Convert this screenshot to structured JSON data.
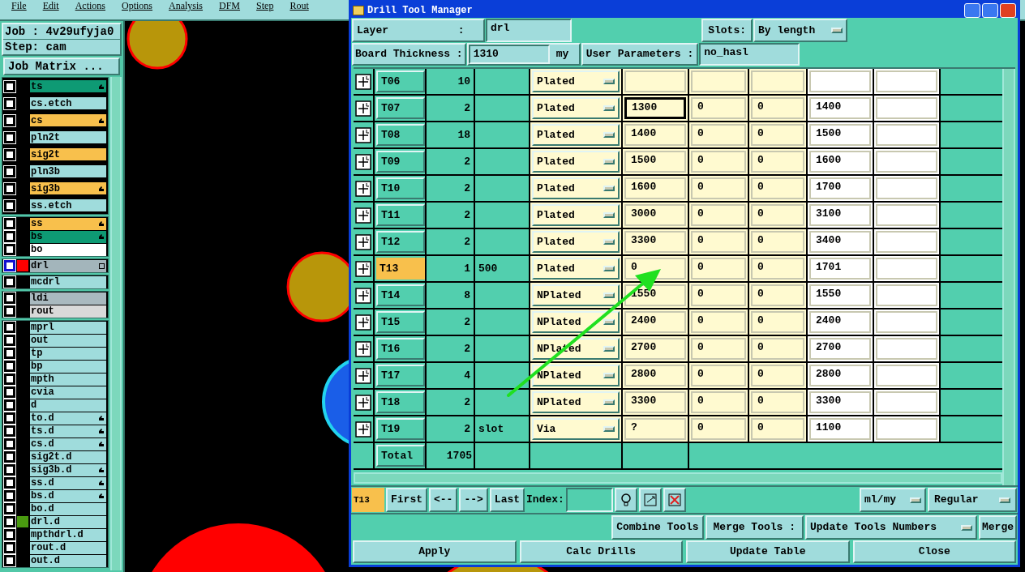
{
  "menu_bar": [
    "File",
    "Edit",
    "Actions",
    "Options",
    "Analysis",
    "DFM",
    "Step",
    "Rout"
  ],
  "job": {
    "job_label": "Job : 4v29ufyja0",
    "step_label": "Step: cam",
    "matrix_button": "Job Matrix ..."
  },
  "layer_groups": [
    [
      {
        "name": "ts",
        "color": "#0e9a74",
        "affected": true,
        "checked": false
      },
      {
        "name": "cs.etch",
        "color": "#9fdcdc",
        "affected": false,
        "checked": false
      },
      {
        "name": "cs",
        "color": "#f8c04c",
        "affected": true,
        "checked": false
      },
      {
        "name": "pln2t",
        "color": "#9fdcdc",
        "affected": false,
        "checked": false
      },
      {
        "name": "sig2t",
        "color": "#f8c04c",
        "affected": false,
        "checked": false
      },
      {
        "name": "pln3b",
        "color": "#9fdcdc",
        "affected": false,
        "checked": false
      },
      {
        "name": "sig3b",
        "color": "#f8c04c",
        "affected": true,
        "checked": false
      },
      {
        "name": "ss.etch",
        "color": "#9fdcdc",
        "affected": false,
        "checked": false
      }
    ],
    [
      {
        "name": "ss",
        "color": "#f8c04c",
        "affected": true,
        "checked": false
      },
      {
        "name": "bs",
        "color": "#0e9a74",
        "affected": true,
        "checked": false
      },
      {
        "name": "bo",
        "color": "#ffffff",
        "affected": false,
        "checked": false
      }
    ],
    [
      {
        "name": "drl",
        "color": "#a3b5bb",
        "affected": false,
        "checked": false,
        "swatch": {
          "color": "#ff0000"
        },
        "work": true
      }
    ],
    [
      {
        "name": "mcdrl",
        "color": "#9fdcdc",
        "affected": false,
        "checked": false
      }
    ],
    [
      {
        "name": "ldi",
        "color": "#a9b9bf",
        "affected": false,
        "checked": false
      },
      {
        "name": "rout",
        "color": "#d9d9d9",
        "affected": false,
        "checked": false
      }
    ],
    [
      {
        "name": "mprl",
        "color": "#9fdcdc",
        "affected": false,
        "checked": false
      },
      {
        "name": "out",
        "color": "#9fdcdc",
        "affected": false,
        "checked": false
      },
      {
        "name": "tp",
        "color": "#9fdcdc",
        "affected": false,
        "checked": false
      },
      {
        "name": "bp",
        "color": "#9fdcdc",
        "affected": false,
        "checked": false
      },
      {
        "name": "mpth",
        "color": "#9fdcdc",
        "affected": false,
        "checked": false
      },
      {
        "name": "cvia",
        "color": "#9fdcdc",
        "affected": false,
        "checked": false
      },
      {
        "name": "d",
        "color": "#9fdcdc",
        "affected": false,
        "checked": false
      },
      {
        "name": "to.d",
        "color": "#9fdcdc",
        "affected": true,
        "checked": false
      },
      {
        "name": "ts.d",
        "color": "#9fdcdc",
        "affected": true,
        "checked": false
      },
      {
        "name": "cs.d",
        "color": "#9fdcdc",
        "affected": true,
        "checked": false
      },
      {
        "name": "sig2t.d",
        "color": "#9fdcdc",
        "affected": false,
        "checked": false
      },
      {
        "name": "sig3b.d",
        "color": "#9fdcdc",
        "affected": true,
        "checked": false
      },
      {
        "name": "ss.d",
        "color": "#9fdcdc",
        "affected": true,
        "checked": false
      },
      {
        "name": "bs.d",
        "color": "#9fdcdc",
        "affected": true,
        "checked": false
      },
      {
        "name": "bo.d",
        "color": "#9fdcdc",
        "affected": false,
        "checked": false
      },
      {
        "name": "drl.d",
        "color": "#9fdcdc",
        "affected": false,
        "checked": false,
        "swatch": {
          "color": "#4a9a10"
        }
      },
      {
        "name": "mpthdrl.d",
        "color": "#9fdcdc",
        "affected": false,
        "checked": false
      },
      {
        "name": "rout.d",
        "color": "#9fdcdc",
        "affected": false,
        "checked": false
      },
      {
        "name": "out.d",
        "color": "#9fdcdc",
        "affected": false,
        "checked": false
      }
    ]
  ],
  "dialog": {
    "title": "Drill Tool Manager",
    "layer_label": "Layer           :",
    "layer_value": "drl",
    "slots_label": "Slots:",
    "slots_value": "By length",
    "thickness_label": "Board Thickness :",
    "thickness_value": "1310",
    "thickness_unit": "my",
    "user_params_label": "User Parameters :",
    "user_params_value": "no_hasl"
  },
  "table": {
    "rows": [
      {
        "tool": "T06",
        "count": "10",
        "type": "Plated",
        "values": [],
        "selected": false,
        "focused": false
      },
      {
        "tool": "T07",
        "count": "2",
        "type": "Plated",
        "values": [
          "1300",
          "0",
          "0",
          "1400"
        ],
        "selected": false,
        "focused": true
      },
      {
        "tool": "T08",
        "count": "18",
        "type": "Plated",
        "values": [
          "1400",
          "0",
          "0",
          "1500"
        ],
        "selected": false,
        "focused": false
      },
      {
        "tool": "T09",
        "count": "2",
        "type": "Plated",
        "values": [
          "1500",
          "0",
          "0",
          "1600"
        ],
        "selected": false,
        "focused": false
      },
      {
        "tool": "T10",
        "count": "2",
        "type": "Plated",
        "values": [
          "1600",
          "0",
          "0",
          "1700"
        ],
        "selected": false,
        "focused": false
      },
      {
        "tool": "T11",
        "count": "2",
        "type": "Plated",
        "values": [
          "3000",
          "0",
          "0",
          "3100"
        ],
        "selected": false,
        "focused": false
      },
      {
        "tool": "T12",
        "count": "2",
        "type": "Plated",
        "values": [
          "3300",
          "0",
          "0",
          "3400"
        ],
        "selected": false,
        "focused": false
      },
      {
        "tool": "T13",
        "count": "1",
        "column_3": "500",
        "type": "Plated",
        "values": [
          "0",
          "0",
          "0",
          "1701"
        ],
        "selected": true,
        "focused": false
      },
      {
        "tool": "T14",
        "count": "8",
        "type": "NPlated",
        "values": [
          "1550",
          "0",
          "0",
          "1550"
        ],
        "selected": false,
        "focused": false
      },
      {
        "tool": "T15",
        "count": "2",
        "type": "NPlated",
        "values": [
          "2400",
          "0",
          "0",
          "2400"
        ],
        "selected": false,
        "focused": false
      },
      {
        "tool": "T16",
        "count": "2",
        "type": "NPlated",
        "values": [
          "2700",
          "0",
          "0",
          "2700"
        ],
        "selected": false,
        "focused": false
      },
      {
        "tool": "T17",
        "count": "4",
        "type": "NPlated",
        "values": [
          "2800",
          "0",
          "0",
          "2800"
        ],
        "selected": false,
        "focused": false
      },
      {
        "tool": "T18",
        "count": "2",
        "type": "NPlated",
        "values": [
          "3300",
          "0",
          "0",
          "3300"
        ],
        "selected": false,
        "focused": false
      },
      {
        "tool": "T19",
        "count": "2",
        "column_3": "slot",
        "type": "Via",
        "values": [
          "?",
          "0",
          "0",
          "1100"
        ],
        "selected": false,
        "focused": false
      }
    ],
    "total": {
      "label": "Total",
      "count": "1705"
    }
  },
  "nav": {
    "current": "T13",
    "buttons": [
      "First",
      "<--",
      "-->",
      "Last"
    ],
    "index_label": "Index:",
    "units": "ml/my",
    "mode": "Regular"
  },
  "merge": {
    "combine": "Combine Tools",
    "merge_label": "Merge Tools :",
    "merge_mode": "Update Tools Numbers",
    "merge_button": "Merge"
  },
  "actions": [
    "Apply",
    "Calc Drills",
    "Update Table",
    "Close"
  ]
}
